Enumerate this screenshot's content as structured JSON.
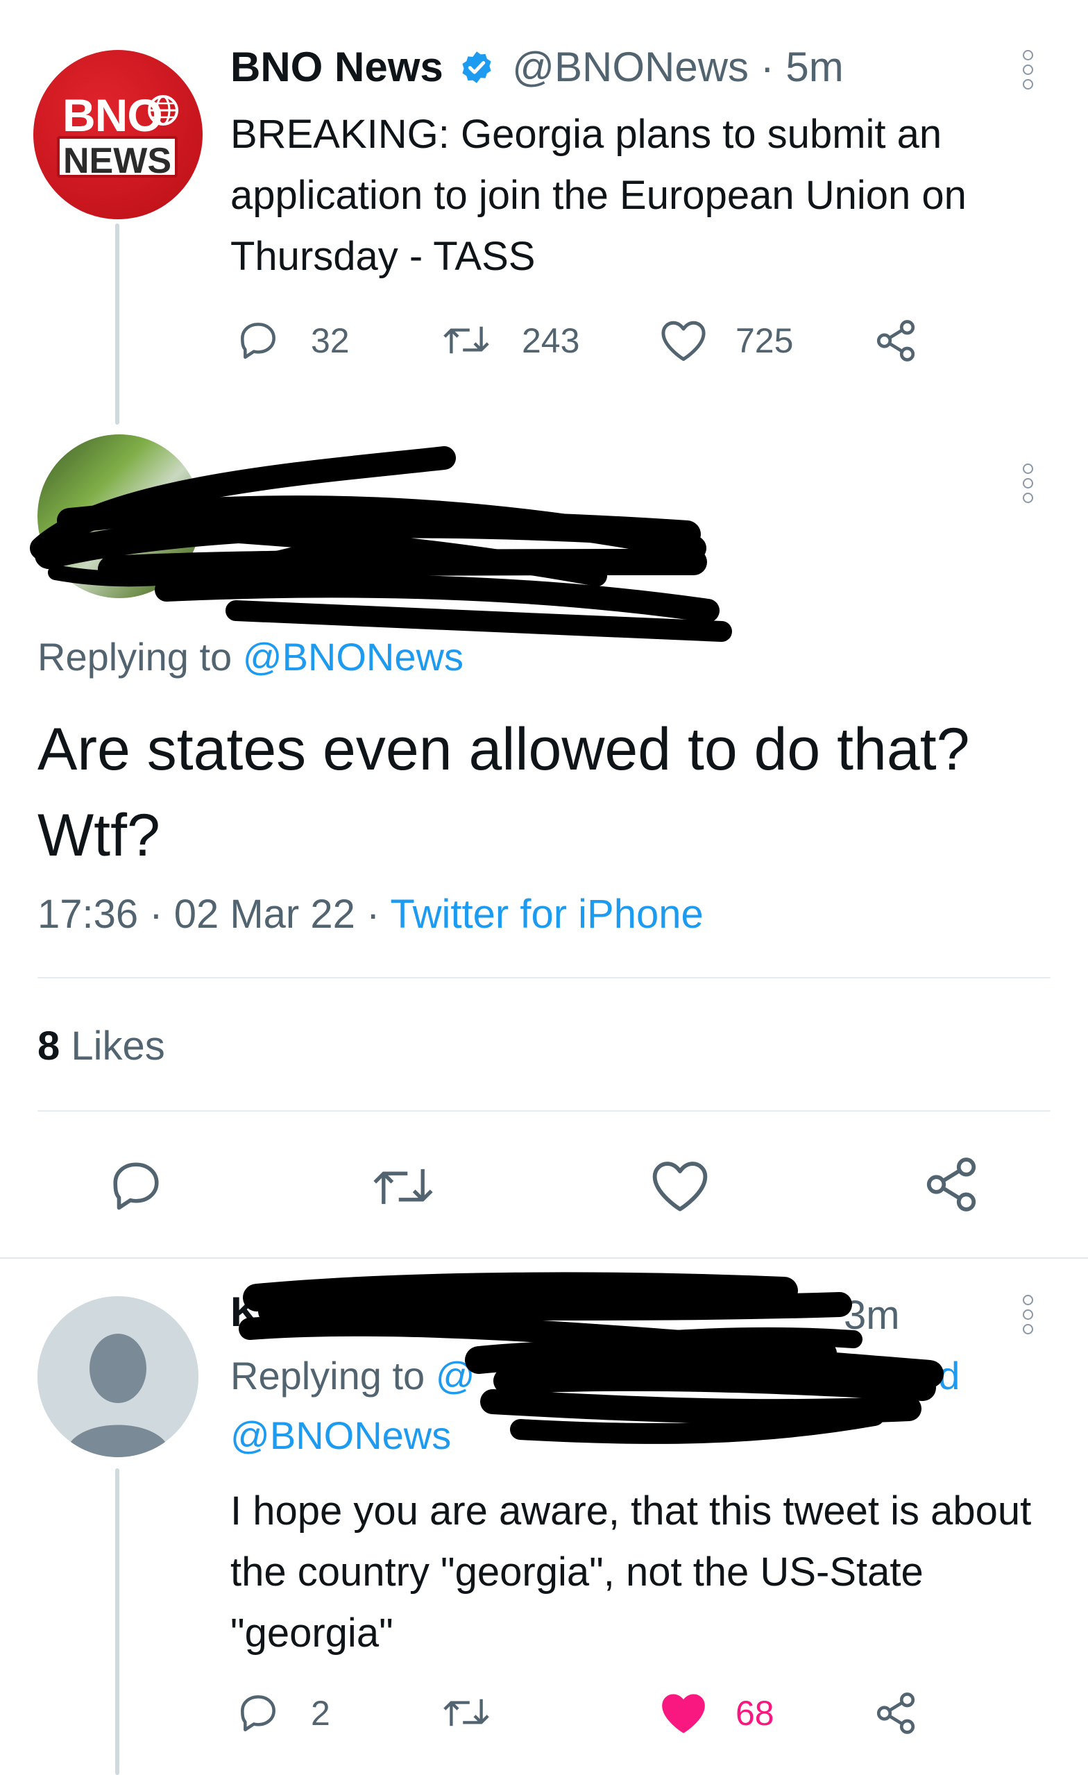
{
  "tweet1": {
    "avatar_top": "BNO",
    "avatar_bottom": "NEWS",
    "name": "BNO News",
    "handle": "@BNONews",
    "sep": "·",
    "time": "5m",
    "text": "BREAKING: Georgia plans to submit an application to join the European Union on Thursday - TASS",
    "replies": "32",
    "retweets": "243",
    "likes": "725"
  },
  "focal": {
    "replying_prefix": "Replying to",
    "replying_handle": "@BNONews",
    "text": "Are states even allowed to do that? Wtf?",
    "time": "17:36",
    "sep1": "·",
    "date": "02 Mar 22",
    "sep2": "·",
    "source": "Twitter for iPhone",
    "likes_count": "8",
    "likes_label": "Likes"
  },
  "reply": {
    "name_visible": "K",
    "time": "3m",
    "replying_prefix": "Replying to",
    "replying_fragment_start": "@",
    "replying_fragment_end": "and",
    "replying_handle2": "@BNONews",
    "text": "I hope you are aware, that this tweet is about the country \"georgia\", not the US-State \"georgia\"",
    "replies": "2",
    "likes": "68"
  },
  "colors": {
    "accent": "#1d9bf0",
    "like_pink": "#f91880",
    "secondary_text": "#536471"
  }
}
